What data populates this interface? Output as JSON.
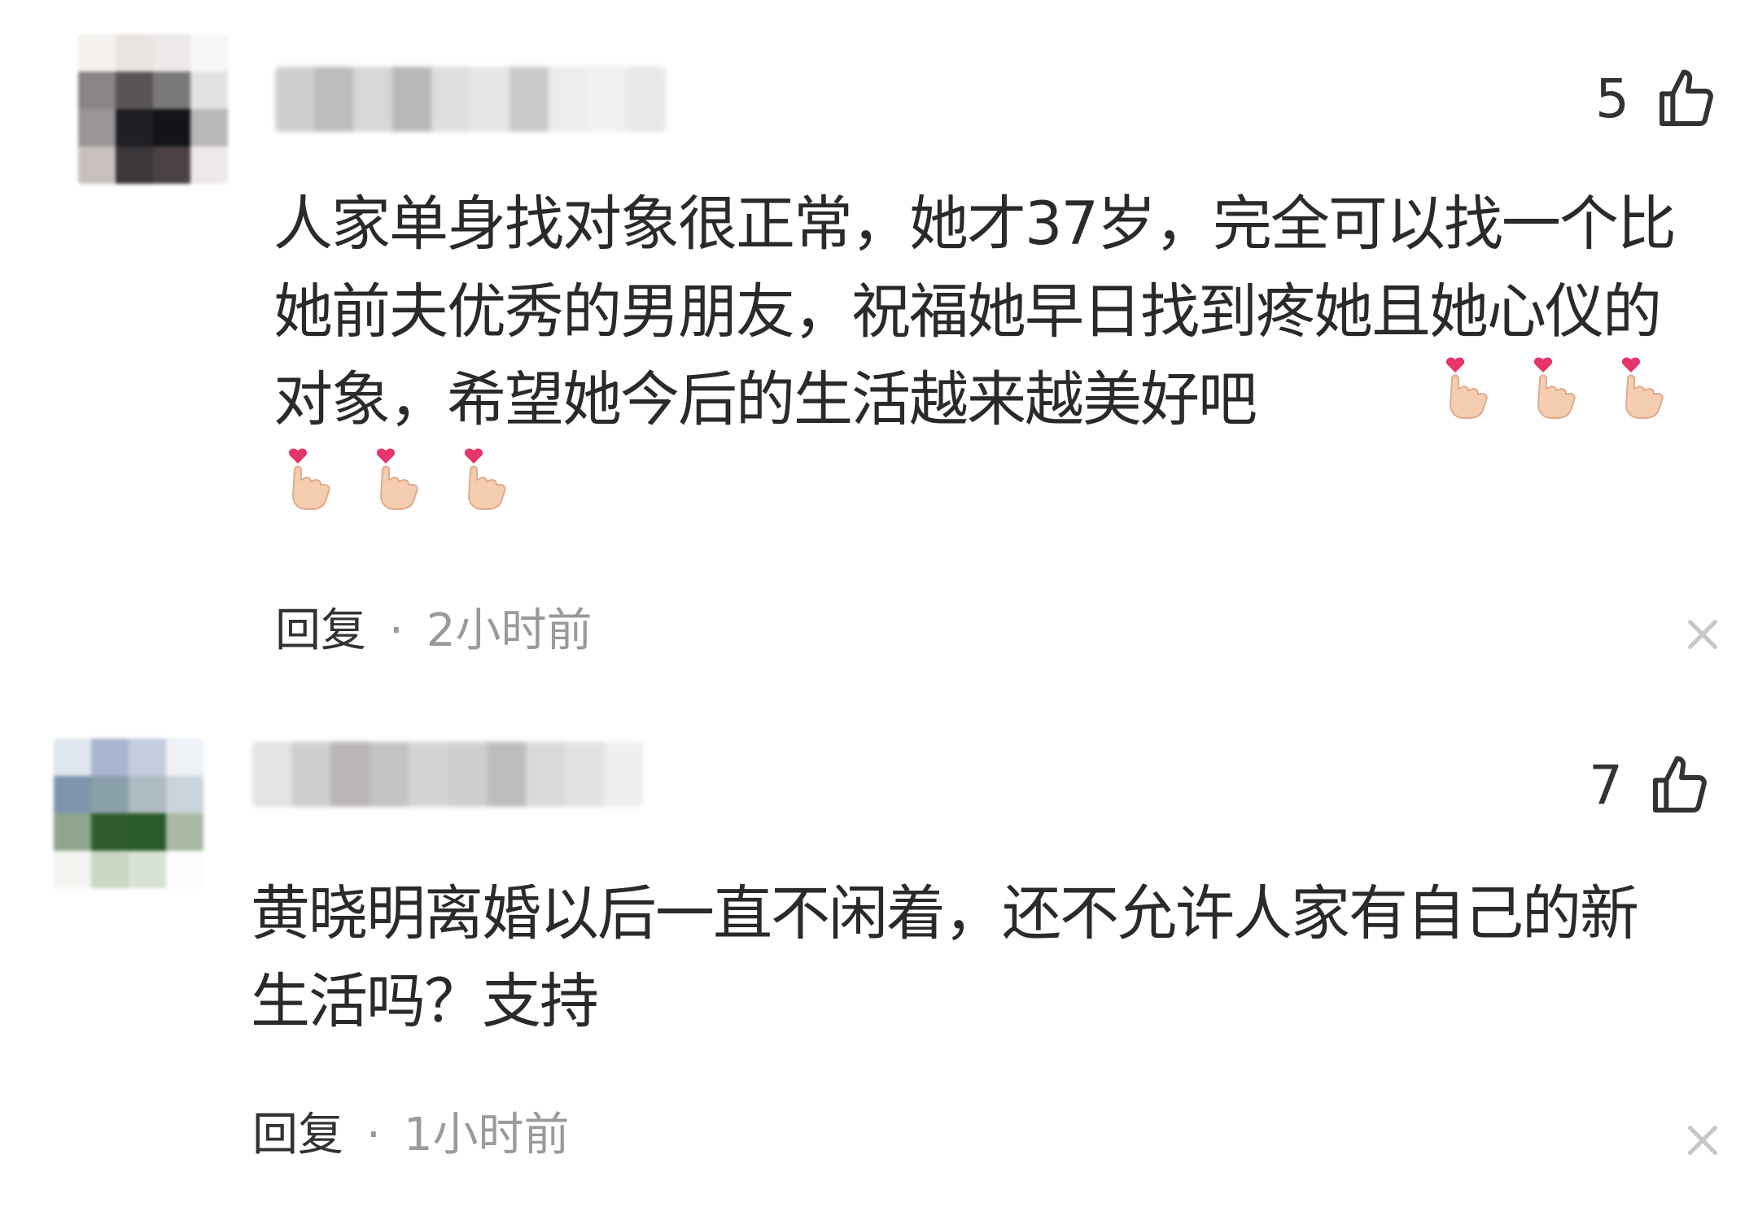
{
  "comments": [
    {
      "likes": "5",
      "text": "人家单身找对象很正常，她才37岁，完全可以找一个比她前夫优秀的男朋友，祝福她早日找到疼她且她心仪的对象，希望她今后的生活越来越美好吧",
      "emoji_icon": "finger-heart-icon",
      "emoji_count": 6,
      "reply_label": "回复",
      "separator": "·",
      "time": "2小时前",
      "avatar_colors": [
        "#f4f1ef",
        "#e9e3e1",
        "#ece9e8",
        "#f7f5f5",
        "#8a8585",
        "#5a5454",
        "#7b7878",
        "#e3e1e1",
        "#9a9696",
        "#1f1f24",
        "#141418",
        "#b9b7b8",
        "#c8c0bf",
        "#3a3639",
        "#4a4143",
        "#efe8e8"
      ],
      "username_colors": [
        "#cfcfcf",
        "#bdbdbd",
        "#d7d7d7",
        "#b8b8b8",
        "#dedede",
        "#e6e6e6",
        "#c9c9c9",
        "#ececec",
        "#f0f0f0",
        "#e8e8e8"
      ]
    },
    {
      "likes": "7",
      "text": "黄晓明离婚以后一直不闲着，还不允许人家有自己的新生活吗？支持",
      "reply_label": "回复",
      "separator": "·",
      "time": "1小时前",
      "avatar_colors": [
        "#dfe6ee",
        "#a9b5d0",
        "#c4cde0",
        "#eef1f6",
        "#7e95ad",
        "#8aa0aa",
        "#aebbc3",
        "#c9d4dc",
        "#8fa58e",
        "#2f5e2c",
        "#2a5a28",
        "#a9b9a3",
        "#f2f5f0",
        "#c9d8c4",
        "#d7e2d2",
        "#fbfcfa"
      ],
      "username_colors": [
        "#e3e3e3",
        "#cfcfcf",
        "#b9b5b5",
        "#c3c3c3",
        "#d4d4d4",
        "#cfcfcf",
        "#bdbdbd",
        "#d9d9d9",
        "#e2e2e2",
        "#eeeeee"
      ]
    }
  ],
  "icons": {
    "like": "thumbs-up-icon",
    "close": "close-icon",
    "emoji": "finger-heart-icon"
  }
}
